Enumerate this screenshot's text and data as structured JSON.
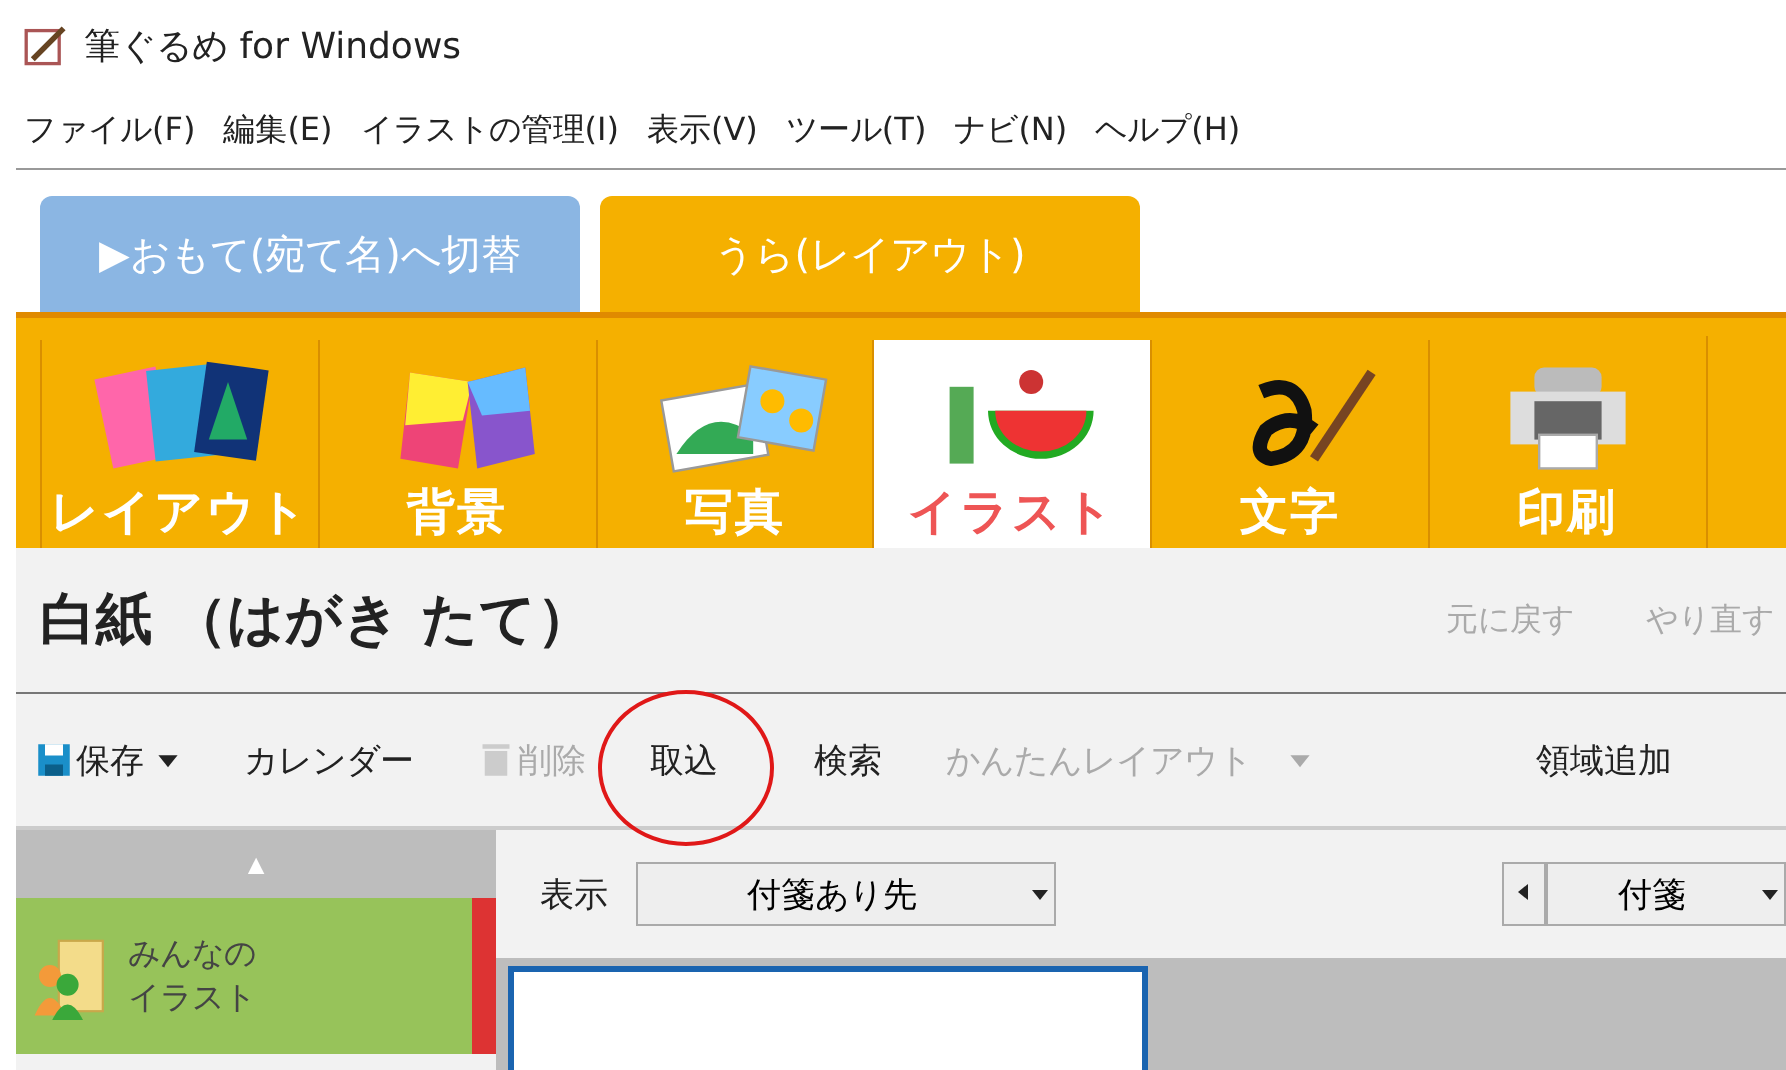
{
  "window": {
    "title": "筆ぐるめ for Windows"
  },
  "menu": [
    "ファイル(F)",
    "編集(E)",
    "イラストの管理(I)",
    "表示(V)",
    "ツール(T)",
    "ナビ(N)",
    "ヘルプ(H)"
  ],
  "mode_tabs": [
    {
      "label": "▶おもて(宛て名)へ切替",
      "selected": false
    },
    {
      "label": "うら(レイアウト)",
      "selected": true
    }
  ],
  "tool_tiles": [
    {
      "kind": "cards",
      "label": "レイアウト",
      "selected": false
    },
    {
      "kind": "paper",
      "label": "背景",
      "selected": false
    },
    {
      "kind": "photo",
      "label": "写真",
      "selected": false
    },
    {
      "kind": "illust",
      "label": "イラスト",
      "selected": true
    },
    {
      "kind": "brush",
      "label": "文字",
      "selected": false
    },
    {
      "kind": "printer",
      "label": "印刷",
      "selected": false
    }
  ],
  "document_title": "白紙 （はがき たて）",
  "history_buttons": [
    {
      "label": "元に戻す",
      "disabled": true
    },
    {
      "label": "やり直す",
      "disabled": true
    }
  ],
  "toolbar": [
    {
      "kind": "save",
      "label": "保存",
      "disabled": false
    },
    {
      "kind": "text",
      "label": "カレンダー",
      "disabled": false
    },
    {
      "kind": "delete",
      "label": "削除",
      "disabled": true
    },
    {
      "kind": "text",
      "label": "取込",
      "disabled": false,
      "circled": true
    },
    {
      "kind": "text",
      "label": "検索",
      "disabled": false
    },
    {
      "kind": "dropdown",
      "label": "かんたんレイアウト",
      "disabled": true
    },
    {
      "kind": "text",
      "label": "領域追加",
      "disabled": false
    }
  ],
  "sidebar": {
    "scroll_up": "▲",
    "items": [
      {
        "label": "みんなのイラスト",
        "selected": true
      }
    ]
  },
  "filter": {
    "label": "表示",
    "value": "付箋あり先",
    "sort_value": "付箋"
  }
}
